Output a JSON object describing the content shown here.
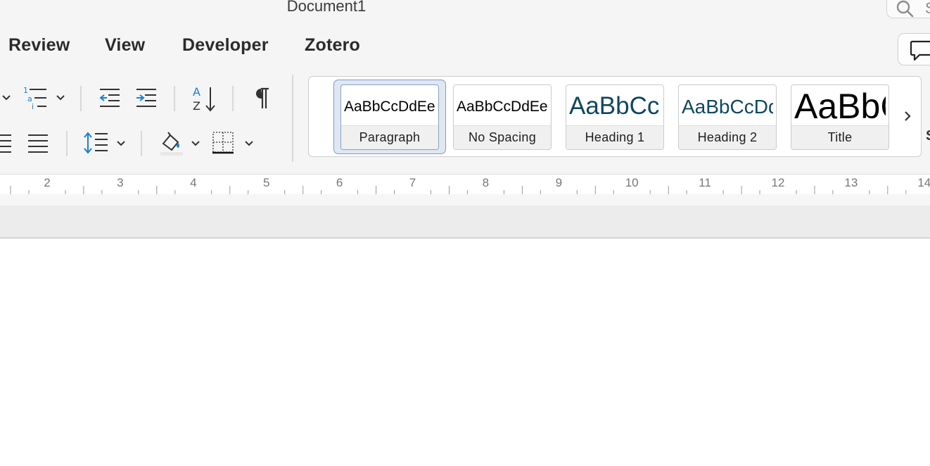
{
  "window": {
    "title": "Document1"
  },
  "search": {
    "visible_text": "S"
  },
  "tabs": [
    {
      "label": "Review"
    },
    {
      "label": "View"
    },
    {
      "label": "Developer"
    },
    {
      "label": "Zotero"
    }
  ],
  "toolbar": {
    "row1": [
      "numbered-list-icon",
      "decrease-indent-icon",
      "increase-indent-icon",
      "sort-icon",
      "pilcrow-icon"
    ],
    "row2": [
      "justify-icon",
      "line-spacing-icon",
      "shading-icon",
      "borders-icon"
    ],
    "accent_color": "#1a7fd4"
  },
  "styles": {
    "items": [
      {
        "preview": "AaBbCcDdEe",
        "label": "Paragraph",
        "selected": true,
        "color": "#000000"
      },
      {
        "preview": "AaBbCcDdEe",
        "label": "No Spacing",
        "selected": false,
        "color": "#000000"
      },
      {
        "preview": "AaBbCcDc",
        "label": "Heading 1",
        "selected": false,
        "color": "#0f4761"
      },
      {
        "preview": "AaBbCcDdE",
        "label": "Heading 2",
        "selected": false,
        "color": "#0f4761"
      },
      {
        "preview": "AaBbCc",
        "label": "Title",
        "selected": false,
        "color": "#000000"
      }
    ],
    "next_icon": "chevron-right-icon",
    "edge_text": "S"
  },
  "ruler": {
    "numbers": [
      "2",
      "3",
      "4",
      "5",
      "6",
      "7",
      "8",
      "9",
      "10",
      "11",
      "12",
      "13",
      "14"
    ]
  }
}
